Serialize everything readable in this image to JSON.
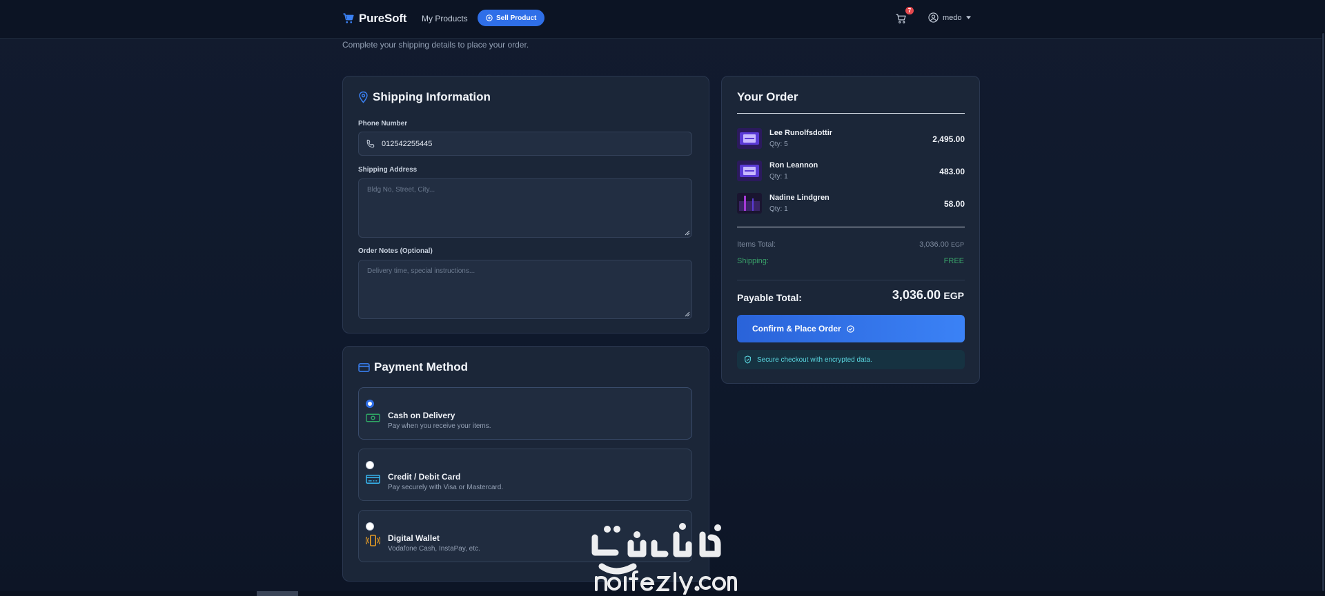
{
  "nav": {
    "brand": "PureSoft",
    "my_products": "My Products",
    "sell_product": "Sell Product",
    "cart_count": "7",
    "username": "medo"
  },
  "subtitle": "Complete your shipping details to place your order.",
  "shipping": {
    "title": "Shipping Information",
    "phone_label": "Phone Number",
    "phone_value": "012542255445",
    "address_label": "Shipping Address",
    "address_placeholder": "Bldg No, Street, City...",
    "notes_label": "Order Notes (Optional)",
    "notes_placeholder": "Delivery time, special instructions..."
  },
  "payment": {
    "title": "Payment Method",
    "options": [
      {
        "title": "Cash on Delivery",
        "desc": "Pay when you receive your items.",
        "selected": true,
        "icon": "cash-icon"
      },
      {
        "title": "Credit / Debit Card",
        "desc": "Pay securely with Visa or Mastercard.",
        "selected": false,
        "icon": "credit-card-icon"
      },
      {
        "title": "Digital Wallet",
        "desc": "Vodafone Cash, InstaPay, etc.",
        "selected": false,
        "icon": "mobile-wallet-icon"
      }
    ]
  },
  "order": {
    "title": "Your Order",
    "items": [
      {
        "name": "Lee Runolfsdottir",
        "qty": "Qty: 5",
        "price": "2,495.00"
      },
      {
        "name": "Ron Leannon",
        "qty": "Qty: 1",
        "price": "483.00"
      },
      {
        "name": "Nadine Lindgren",
        "qty": "Qty: 1",
        "price": "58.00"
      }
    ],
    "items_total_label": "Items Total:",
    "items_total_value": "3,036.00",
    "currency": "EGP",
    "shipping_label": "Shipping:",
    "shipping_value": "FREE",
    "payable_label": "Payable Total:",
    "payable_value": "3,036.00",
    "confirm_label": "Confirm & Place Order",
    "secure_text": "Secure checkout with encrypted data."
  },
  "colors": {
    "accent": "#2f6fe8",
    "background": "#111a2c",
    "card": "#1b2638",
    "success": "#3aa26a",
    "secure_text": "#5ad7e0"
  },
  "watermark": {
    "arabic": "نفذلي",
    "latin": "nafezly.com"
  }
}
